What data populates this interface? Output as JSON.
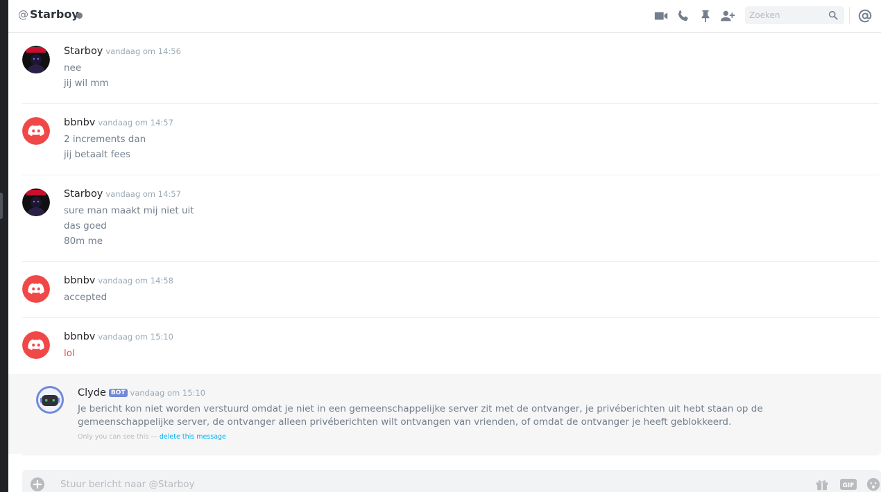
{
  "header": {
    "at_symbol": "@",
    "channel_name": "Starboy",
    "status": "offline",
    "search_placeholder": "Zoeken",
    "icons": [
      "video-call-icon",
      "voice-call-icon",
      "pinned-messages-icon",
      "add-friend-icon",
      "search-icon",
      "mentions-icon"
    ]
  },
  "messages": [
    {
      "author": "Starboy",
      "timestamp": "vandaag om 14:56",
      "avatar": "starboy",
      "lines": [
        "nee",
        "jij wil mm"
      ]
    },
    {
      "author": "bbnbv",
      "timestamp": "vandaag om 14:57",
      "avatar": "discord-default",
      "lines": [
        "2 increments dan",
        "jij betaalt fees"
      ]
    },
    {
      "author": "Starboy",
      "timestamp": "vandaag om 14:57",
      "avatar": "starboy",
      "lines": [
        "sure man maakt mij niet uit",
        "das goed",
        "80m me"
      ]
    },
    {
      "author": "bbnbv",
      "timestamp": "vandaag om 14:58",
      "avatar": "discord-default",
      "lines": [
        "accepted"
      ]
    },
    {
      "author": "bbnbv",
      "timestamp": "vandaag om 15:10",
      "avatar": "discord-default",
      "lines": [
        "lol"
      ],
      "failed": true
    }
  ],
  "clyde": {
    "author": "Clyde",
    "bot_tag": "BOT",
    "timestamp": "vandaag om 15:10",
    "text": "Je bericht kon niet worden verstuurd omdat je niet in een gemeenschappelijke server zit met de ontvanger, je privéberichten uit hebt staan op de gemeenschappelijke server, de ontvanger alleen privéberichten wilt ontvangen van vrienden, of omdat de ontvanger je heeft geblokkeerd.",
    "note_prefix": "Only you can see this —",
    "note_link": "delete this message"
  },
  "composer": {
    "placeholder": "Stuur bericht naar @Starboy",
    "gif_label": "GIF"
  },
  "colors": {
    "accent_bot": "#7289da",
    "discord_red": "#f04747",
    "link_blue": "#00b0f4"
  }
}
